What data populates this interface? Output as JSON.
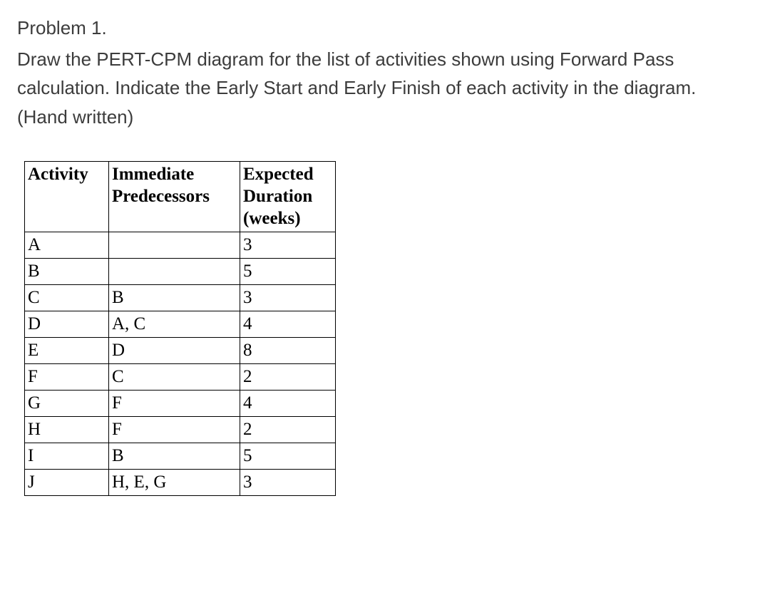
{
  "problem": {
    "title": "Problem 1.",
    "text": "Draw the PERT-CPM diagram for the list of activities shown using Forward Pass calculation. Indicate the Early Start and Early Finish of each activity in the diagram. (Hand written)"
  },
  "table": {
    "headers": {
      "activity": "Activity",
      "predecessors_line1": "Immediate",
      "predecessors_line2": "Predecessors",
      "duration_line1": "Expected",
      "duration_line2": "Duration",
      "duration_line3": "(weeks)"
    },
    "rows": [
      {
        "activity": "A",
        "predecessors": "",
        "duration": "3"
      },
      {
        "activity": "B",
        "predecessors": "",
        "duration": "5"
      },
      {
        "activity": "C",
        "predecessors": "B",
        "duration": "3"
      },
      {
        "activity": "D",
        "predecessors": "A, C",
        "duration": "4"
      },
      {
        "activity": "E",
        "predecessors": "D",
        "duration": "8"
      },
      {
        "activity": "F",
        "predecessors": "C",
        "duration": "2"
      },
      {
        "activity": "G",
        "predecessors": "F",
        "duration": "4"
      },
      {
        "activity": "H",
        "predecessors": "F",
        "duration": "2"
      },
      {
        "activity": "I",
        "predecessors": "B",
        "duration": "5"
      },
      {
        "activity": "J",
        "predecessors": "H, E, G",
        "duration": "3"
      }
    ]
  },
  "chart_data": {
    "type": "table",
    "title": "PERT-CPM Activities",
    "columns": [
      "Activity",
      "Immediate Predecessors",
      "Expected Duration (weeks)"
    ],
    "rows": [
      [
        "A",
        "",
        3
      ],
      [
        "B",
        "",
        5
      ],
      [
        "C",
        "B",
        3
      ],
      [
        "D",
        "A, C",
        4
      ],
      [
        "E",
        "D",
        8
      ],
      [
        "F",
        "C",
        2
      ],
      [
        "G",
        "F",
        4
      ],
      [
        "H",
        "F",
        2
      ],
      [
        "I",
        "B",
        5
      ],
      [
        "J",
        "H, E, G",
        3
      ]
    ]
  }
}
